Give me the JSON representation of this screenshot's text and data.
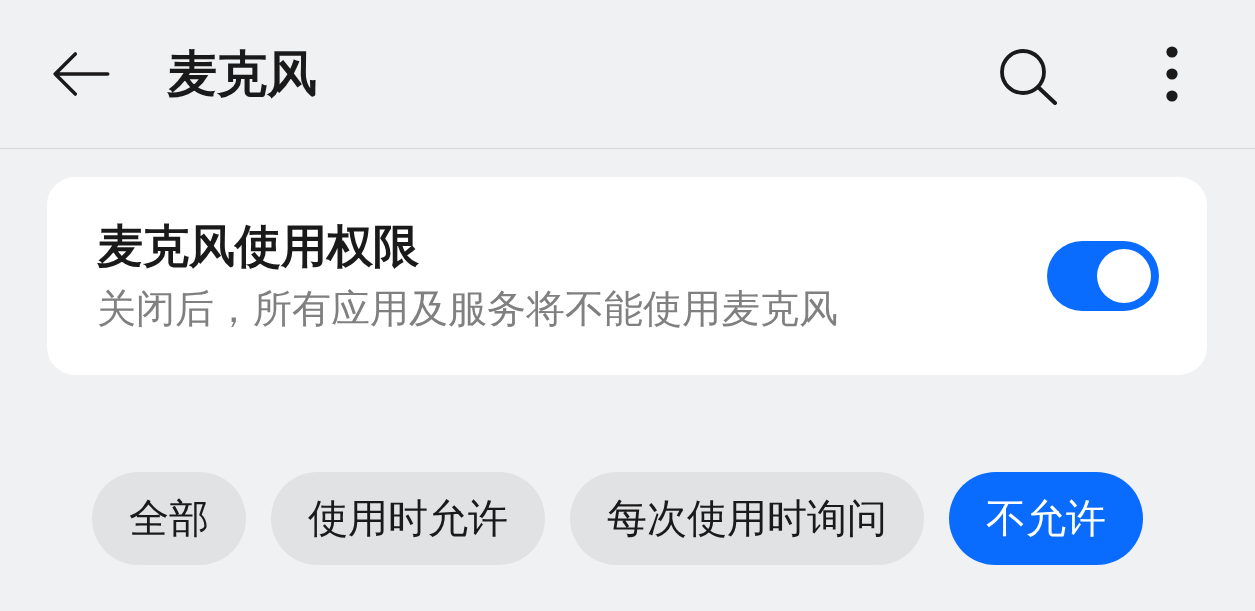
{
  "header": {
    "title": "麦克风"
  },
  "permission": {
    "title": "麦克风使用权限",
    "description": "关闭后，所有应用及服务将不能使用麦克风",
    "enabled": true
  },
  "filters": [
    {
      "label": "全部",
      "selected": false
    },
    {
      "label": "使用时允许",
      "selected": false
    },
    {
      "label": "每次使用时询问",
      "selected": false
    },
    {
      "label": "不允许",
      "selected": true
    }
  ]
}
